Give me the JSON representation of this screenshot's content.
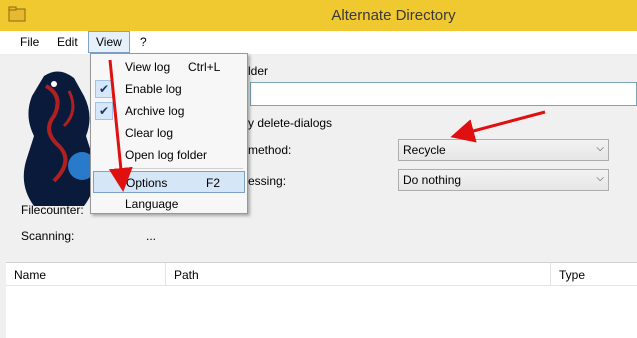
{
  "window": {
    "title": "Alternate Directory"
  },
  "menubar": {
    "items": [
      "File",
      "Edit",
      "View",
      "?"
    ]
  },
  "view_menu": {
    "items": [
      {
        "label": "View log",
        "shortcut": "Ctrl+L",
        "checked": false
      },
      {
        "label": "Enable log",
        "shortcut": "",
        "checked": true
      },
      {
        "label": "Archive log",
        "shortcut": "",
        "checked": true
      },
      {
        "label": "Clear log",
        "shortcut": "",
        "checked": false
      },
      {
        "label": "Open log folder",
        "shortcut": "",
        "checked": false
      },
      {
        "label": "Options",
        "shortcut": "F2",
        "checked": false,
        "highlighted": true
      },
      {
        "label": "Language",
        "shortcut": "",
        "checked": false
      }
    ]
  },
  "main": {
    "folder_hint": "lder",
    "delete_dialogs_label": "y delete-dialogs",
    "method_label": "method:",
    "method_value": "Recycle",
    "processing_label": "essing:",
    "processing_value": "Do nothing",
    "filecounter_label": "Filecounter:",
    "scanning_label": "Scanning:",
    "scanning_value": "..."
  },
  "list": {
    "columns": [
      "Name",
      "Path",
      "Type"
    ]
  },
  "colors": {
    "titlebar": "#f0c830",
    "annotation_arrow": "#e01010",
    "highlight": "#d5e6f7"
  }
}
